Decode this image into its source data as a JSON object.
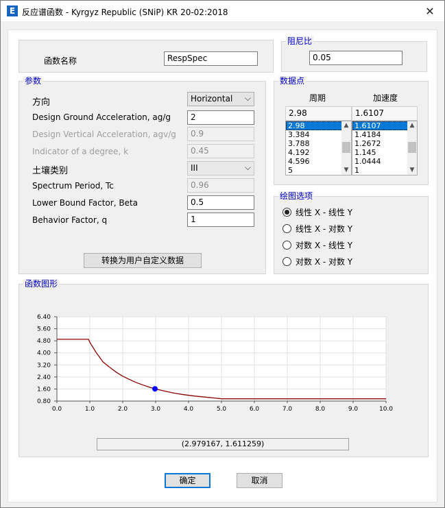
{
  "window": {
    "app_icon": "E",
    "title": "反应谱函数 - Kyrgyz Republic (SNiP) KR 20-02:2018",
    "close": "✕"
  },
  "function_name": {
    "label": "函数名称",
    "value": "RespSpec"
  },
  "damping": {
    "title": "阻尼比",
    "value": "0.05"
  },
  "params": {
    "title": "参数",
    "direction": {
      "label": "方向",
      "value": "Horizontal"
    },
    "ground_accel": {
      "label": "Design Ground Acceleration, ag/g",
      "value": "2"
    },
    "vertical_accel": {
      "label": "Design Vertical Acceleration, agv/g",
      "value": "0.9"
    },
    "indicator": {
      "label": "Indicator of a degree, k",
      "value": "0.45"
    },
    "soil": {
      "label": "土壤类别",
      "value": "III"
    },
    "spectrum_period": {
      "label": "Spectrum Period, Tc",
      "value": "0.96"
    },
    "lower_bound": {
      "label": "Lower Bound Factor, Beta",
      "value": "0.5"
    },
    "behavior": {
      "label": "Behavior Factor, q",
      "value": "1"
    },
    "convert_button": "转换为用户自定义数据"
  },
  "data_points": {
    "title": "数据点",
    "col_period": "周期",
    "col_accel": "加速度",
    "current_period": "2.98",
    "current_accel": "1.6107",
    "periods": [
      "2.98",
      "3.384",
      "3.788",
      "4.192",
      "4.596",
      "5"
    ],
    "accels": [
      "1.6107",
      "1.4184",
      "1.2672",
      "1.145",
      "1.0444",
      "1"
    ]
  },
  "plot_options": {
    "title": "绘图选项",
    "options": [
      "线性 X - 线性 Y",
      "线性 X - 对数 Y",
      "对数 X - 线性 Y",
      "对数 X - 对数 Y"
    ],
    "selected_index": 0
  },
  "graph": {
    "title": "函数图形",
    "coords": "(2.979167, 1.611259)"
  },
  "buttons": {
    "ok": "确定",
    "cancel": "取消"
  },
  "chart_data": {
    "type": "line",
    "title": "",
    "xlabel": "",
    "ylabel": "",
    "xlim": [
      0,
      10
    ],
    "ylim": [
      0.8,
      6.4
    ],
    "x_ticks": [
      "0.0",
      "1.0",
      "2.0",
      "3.0",
      "4.0",
      "5.0",
      "6.0",
      "7.0",
      "8.0",
      "9.0",
      "10.0"
    ],
    "y_ticks": [
      "0.80",
      "1.60",
      "2.40",
      "3.20",
      "4.00",
      "4.80",
      "5.60",
      "6.40"
    ],
    "grid": true,
    "line_color": "#8b0000",
    "marker_color": "#0000ff",
    "series": [
      {
        "x": [
          0,
          0.96,
          1.0,
          1.2,
          1.4,
          1.6,
          1.8,
          2.0,
          2.2,
          2.4,
          2.6,
          2.8,
          2.98,
          3.2,
          3.5,
          3.8,
          4.2,
          4.6,
          4.8,
          5.0,
          6.0,
          7.0,
          8.0,
          9.0,
          10.0
        ],
        "y": [
          4.9,
          4.9,
          4.7,
          4.0,
          3.4,
          3.05,
          2.72,
          2.45,
          2.24,
          2.04,
          1.88,
          1.73,
          1.61,
          1.5,
          1.35,
          1.24,
          1.13,
          1.04,
          1.0,
          0.95,
          0.95,
          0.95,
          0.95,
          0.95,
          0.95
        ]
      }
    ],
    "marker": {
      "x": 2.98,
      "y": 1.6107
    }
  }
}
